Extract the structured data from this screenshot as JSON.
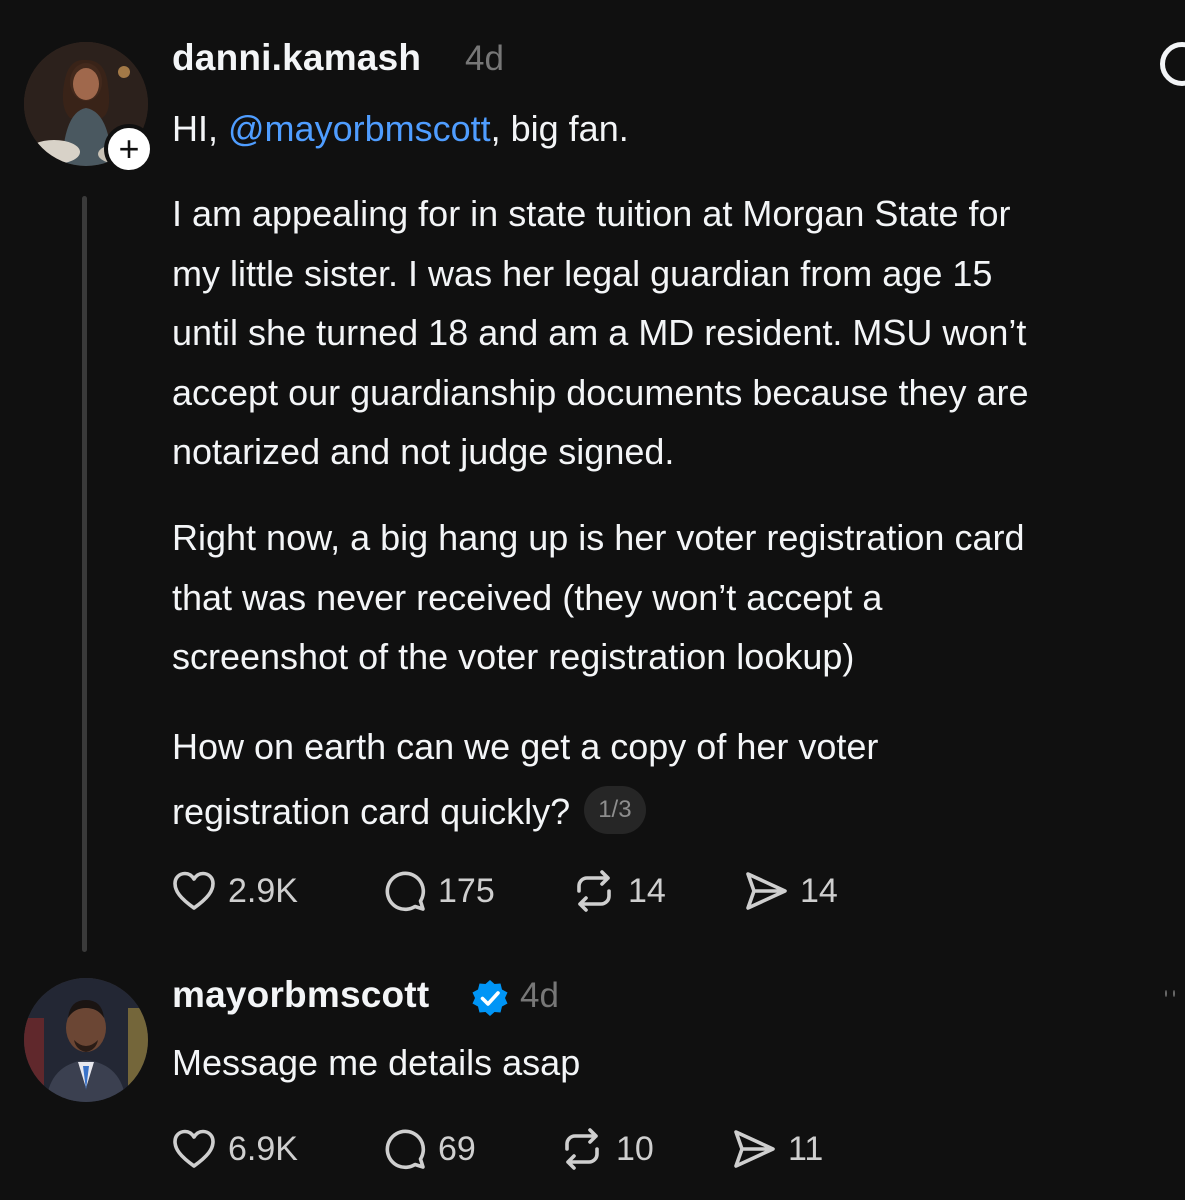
{
  "thread": {
    "post1": {
      "username": "danni.kamash",
      "time": "4d",
      "greeting": {
        "prefix": "HI, ",
        "mention": "@mayorbmscott",
        "suffix": ", big fan."
      },
      "paragraph1": [
        "I am appealing for in state tuition at Morgan State for",
        "my little sister. I was her legal guardian from age 15",
        "until she turned 18 and am a MD resident. MSU won’t",
        "accept our guardianship documents because they are",
        "notarized and not judge signed."
      ],
      "paragraph2": [
        "Right now, a big hang up is her voter registration card",
        "that was never received (they won’t accept a",
        "screenshot of the voter registration lookup)"
      ],
      "paragraph3": [
        "How on earth can we get a copy of her voter",
        "registration card quickly?"
      ],
      "page_counter": "1/3",
      "actions": {
        "likes": "2.9K",
        "replies": "175",
        "reposts": "14",
        "shares": "14"
      }
    },
    "post2": {
      "username": "mayorbmscott",
      "verified": true,
      "time": "4d",
      "text": "Message me details asap",
      "actions": {
        "likes": "6.9K",
        "replies": "69",
        "reposts": "10",
        "shares": "11"
      }
    }
  },
  "colors": {
    "background": "#101010",
    "text": "#f3f5f7",
    "muted": "#777777",
    "mention": "#4f9dff",
    "verified": "#0095f6"
  },
  "icons": [
    "heart-icon",
    "comment-icon",
    "repost-icon",
    "share-icon",
    "plus-icon",
    "verified-badge-icon",
    "more-icon"
  ]
}
